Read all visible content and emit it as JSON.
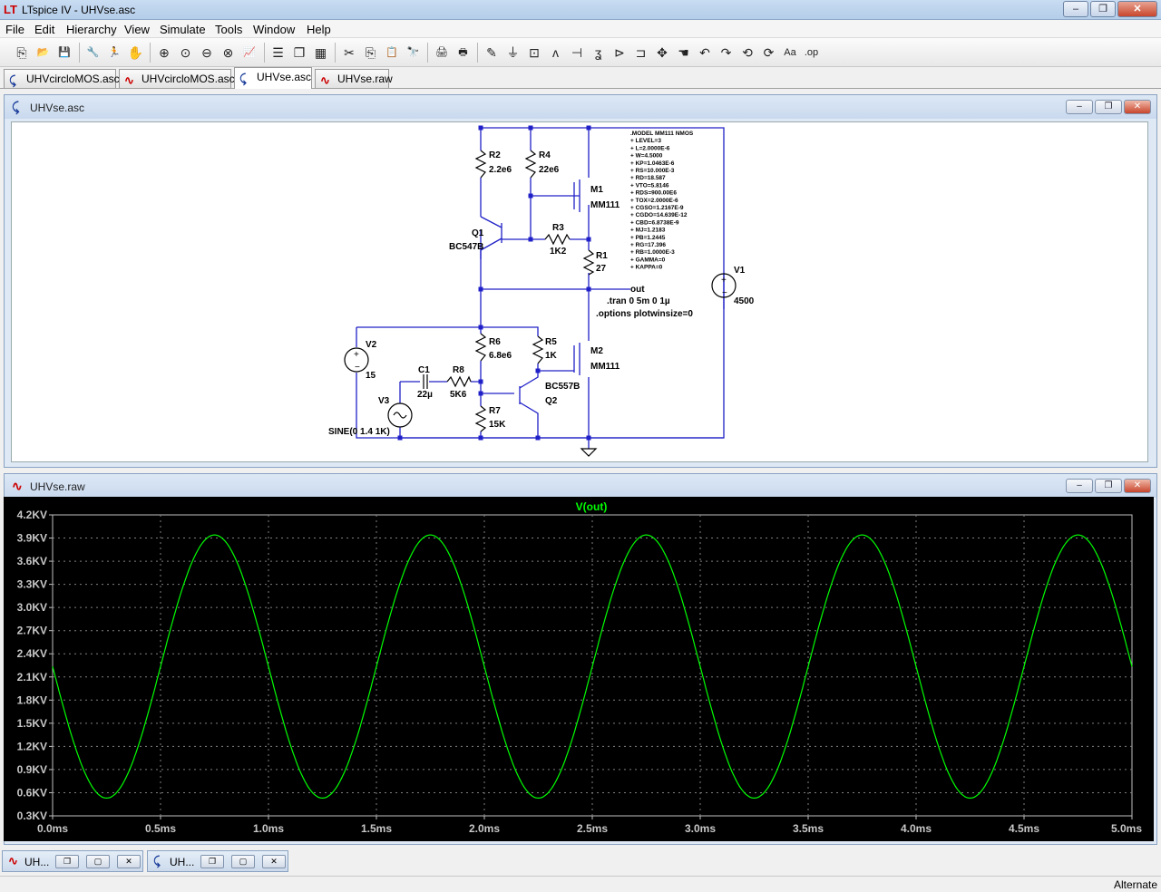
{
  "window": {
    "title": "LTspice IV - UHVse.asc",
    "app_icon": "ltspice-logo-icon",
    "minimize": "–",
    "maximize": "❐",
    "close": "✕"
  },
  "menu": [
    "File",
    "Edit",
    "Hierarchy",
    "View",
    "Simulate",
    "Tools",
    "Window",
    "Help"
  ],
  "toolbar": {
    "icons": [
      "new-schematic-icon",
      "open-icon",
      "save-icon",
      "control-panel-icon",
      "run-icon",
      "halt-icon",
      "zoom-in-icon",
      "pan-icon",
      "zoom-out-icon",
      "zoom-fit-icon",
      "autorange-icon",
      "tile-horizontal-icon",
      "cascade-icon",
      "tile-vertical-icon",
      "cut-icon",
      "copy-icon",
      "paste-icon",
      "find-icon",
      "print-setup-icon",
      "print-icon",
      "draw-wire-icon",
      "ground-icon",
      "label-net-icon",
      "resistor-icon",
      "capacitor-icon",
      "inductor-icon",
      "diode-icon",
      "component-icon",
      "move-icon",
      "drag-icon",
      "undo-icon",
      "redo-icon",
      "rotate-icon",
      "mirror-icon",
      "text-icon",
      "spice-directive-icon"
    ],
    "glyphs": [
      "⎘",
      "📂",
      "💾",
      "🔧",
      "🏃",
      "✋",
      "⊕",
      "⊙",
      "⊖",
      "⊗",
      "📈",
      "☰",
      "❐",
      "▦",
      "✂",
      "⎘",
      "📋",
      "🔭",
      "🖨",
      "🖶",
      "✎",
      "⏚",
      "⊡",
      "ᴧ",
      "⊣",
      "ʓ",
      "⊳",
      "⊐",
      "✥",
      "☚",
      "↶",
      "↷",
      "⟲",
      "⟳",
      "Aa",
      ".op"
    ]
  },
  "tabs": [
    {
      "label": "UHVcircloMOS.asc",
      "icon": "schematic-icon"
    },
    {
      "label": "UHVcircloMOS.asc",
      "icon": "waveform-icon"
    },
    {
      "label": "UHVse.asc",
      "icon": "schematic-icon",
      "active": true
    },
    {
      "label": "UHVse.raw",
      "icon": "waveform-icon"
    }
  ],
  "schematic_window": {
    "title": "UHVse.asc",
    "components": {
      "R2": {
        "name": "R2",
        "value": "2.2e6"
      },
      "R4": {
        "name": "R4",
        "value": "22e6"
      },
      "M1": {
        "name": "M1",
        "value": "MM111"
      },
      "Q1": {
        "name": "Q1",
        "value": "BC547B"
      },
      "R3": {
        "name": "R3",
        "value": "1K2"
      },
      "R1": {
        "name": "R1",
        "value": "27"
      },
      "V1": {
        "name": "V1",
        "value": "4500"
      },
      "V2": {
        "name": "V2",
        "value": "15"
      },
      "R6": {
        "name": "R6",
        "value": "6.8e6"
      },
      "R5": {
        "name": "R5",
        "value": "1K"
      },
      "M2": {
        "name": "M2",
        "value": "MM111"
      },
      "C1": {
        "name": "C1",
        "value": "22µ"
      },
      "R8": {
        "name": "R8",
        "value": "5K6"
      },
      "V3": {
        "name": "V3",
        "value": "SINE(0 1.4 1K)"
      },
      "Q2": {
        "name": "Q2",
        "value": "BC557B"
      },
      "R7": {
        "name": "R7",
        "value": "15K"
      }
    },
    "net_label": "out",
    "directives": [
      ".tran 0 5m 0 1µ",
      ".options plotwinsize=0"
    ],
    "model_lines": [
      ".MODEL MM111 NMOS",
      "+ LEVEL=3",
      "+ L=2.0000E-6",
      "+ W=4.5000",
      "+ KP=1.0463E-6",
      "+ RS=10.000E-3",
      "+ RD=18.587",
      "+ VTO=5.8146",
      "+ RDS=900.00E6",
      "+ TOX=2.0000E-6",
      "+ CGSO=1.2167E-9",
      "+ CGDO=14.639E-12",
      "+ CBD=6.8738E-9",
      "+ MJ=1.2183",
      "+ PB=1.2445",
      "+ RG=17.396",
      "+ RB=1.0000E-3",
      "+ GAMMA=0",
      "+ KAPPA=0"
    ]
  },
  "plot_window": {
    "title": "UHVse.raw"
  },
  "chart_data": {
    "type": "line",
    "title": "",
    "xlabel": "",
    "ylabel": "",
    "legend": "top-center",
    "grid": true,
    "xlim": [
      0,
      5
    ],
    "ylim": [
      0.3,
      4.2
    ],
    "x_ticks": [
      "0.0ms",
      "0.5ms",
      "1.0ms",
      "1.5ms",
      "2.0ms",
      "2.5ms",
      "3.0ms",
      "3.5ms",
      "4.0ms",
      "4.5ms",
      "5.0ms"
    ],
    "y_ticks": [
      "0.3KV",
      "0.6KV",
      "0.9KV",
      "1.2KV",
      "1.5KV",
      "1.8KV",
      "2.1KV",
      "2.4KV",
      "2.7KV",
      "3.0KV",
      "3.3KV",
      "3.6KV",
      "3.9KV",
      "4.2KV"
    ],
    "series": [
      {
        "name": "V(out)",
        "color": "#00ff00",
        "x": [
          0,
          0.25,
          0.75,
          1.25,
          1.75,
          2.25,
          2.75,
          3.25,
          3.75,
          4.25,
          4.75,
          5.0
        ],
        "y": [
          2.24,
          0.53,
          3.94,
          0.53,
          3.94,
          0.53,
          3.94,
          0.53,
          3.94,
          0.53,
          3.94,
          2.24
        ],
        "model": {
          "offset": 2.235,
          "amplitude": 1.705,
          "frequency_per_ms": 1.0,
          "phase": "sin",
          "sign": -1
        }
      }
    ]
  },
  "minimized": [
    {
      "label": "UH...",
      "icon": "waveform-icon"
    },
    {
      "label": "UH...",
      "icon": "schematic-icon"
    }
  ],
  "status": "Alternate",
  "colors": {
    "wire": "#2020c8",
    "trace": "#00ff00",
    "grid": "#808080",
    "background": "#000000"
  }
}
